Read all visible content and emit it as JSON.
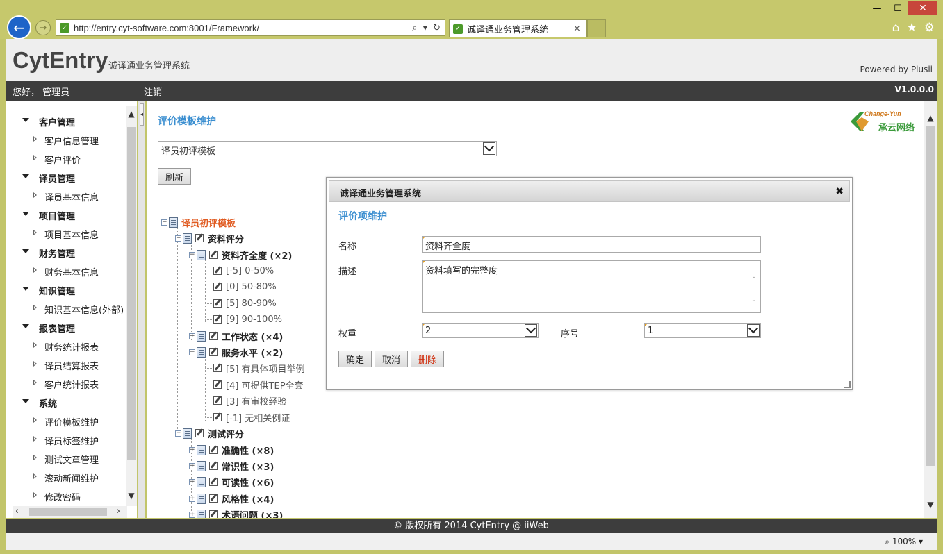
{
  "browser": {
    "url": "http://entry.cyt-software.com:8001/Framework/",
    "tab_title": "诚译通业务管理系统",
    "zoom": "100%",
    "window_min": "—",
    "window_max": "☐",
    "window_close": "✕",
    "tab_close": "×"
  },
  "header": {
    "logo": "CytEntry",
    "subtitle": "诚译通业务管理系统",
    "powered": "Powered by Plusii"
  },
  "topbar": {
    "greeting": "您好， 管理员",
    "logout": "注销",
    "version": "V1.0.0.0"
  },
  "sidebar": {
    "groups": [
      {
        "label": "客户管理",
        "items": [
          "客户信息管理",
          "客户评价"
        ]
      },
      {
        "label": "译员管理",
        "items": [
          "译员基本信息"
        ]
      },
      {
        "label": "项目管理",
        "items": [
          "项目基本信息"
        ]
      },
      {
        "label": "财务管理",
        "items": [
          "财务基本信息"
        ]
      },
      {
        "label": "知识管理",
        "items": [
          "知识基本信息(外部)"
        ]
      },
      {
        "label": "报表管理",
        "items": [
          "财务统计报表",
          "译员结算报表",
          "客户统计报表"
        ]
      },
      {
        "label": "系统",
        "items": [
          "评价模板维护",
          "译员标签维护",
          "测试文章管理",
          "滚动新闻维护",
          "修改密码"
        ]
      }
    ]
  },
  "main": {
    "title": "评价模板维护",
    "brand_en": "Change-Yun",
    "brand_cn": "承云网络",
    "template_select": "译员初评模板",
    "refresh_label": "刷新"
  },
  "tree": {
    "root": "译员初评模板",
    "n1": "资料评分",
    "n1_1": "资料齐全度 (×2)",
    "n1_1_a": "[-5] 0-50%",
    "n1_1_b": "[0] 50-80%",
    "n1_1_c": "[5] 80-90%",
    "n1_1_d": "[9] 90-100%",
    "n1_2": "工作状态 (×4)",
    "n1_3": "服务水平 (×2)",
    "n1_3_a": "[5] 有具体项目举例",
    "n1_3_b": "[4] 可提供TEP全套",
    "n1_3_c": "[3] 有审校经验",
    "n1_3_d": "[-1] 无相关例证",
    "n2": "测试评分",
    "n2_1": "准确性 (×8)",
    "n2_2": "常识性 (×3)",
    "n2_3": "可读性 (×6)",
    "n2_4": "风格性 (×4)",
    "n2_5": "术语问题 (×3)"
  },
  "dialog": {
    "title": "诚译通业务管理系统",
    "close": "✖",
    "heading": "评价项维护",
    "name_label": "名称",
    "name_value": "资料齐全度",
    "desc_label": "描述",
    "desc_value": "资料填写的完整度",
    "weight_label": "权重",
    "weight_value": "2",
    "order_label": "序号",
    "order_value": "1",
    "ok_label": "确定",
    "cancel_label": "取消",
    "delete_label": "删除"
  },
  "footer": {
    "copyright": "© 版权所有 2014 CytEntry @ iiWeb"
  },
  "colors": {
    "accent": "#3a8ed0",
    "root_node": "#e05a20",
    "delete": "#d03010",
    "bar": "#3d3d3d"
  }
}
